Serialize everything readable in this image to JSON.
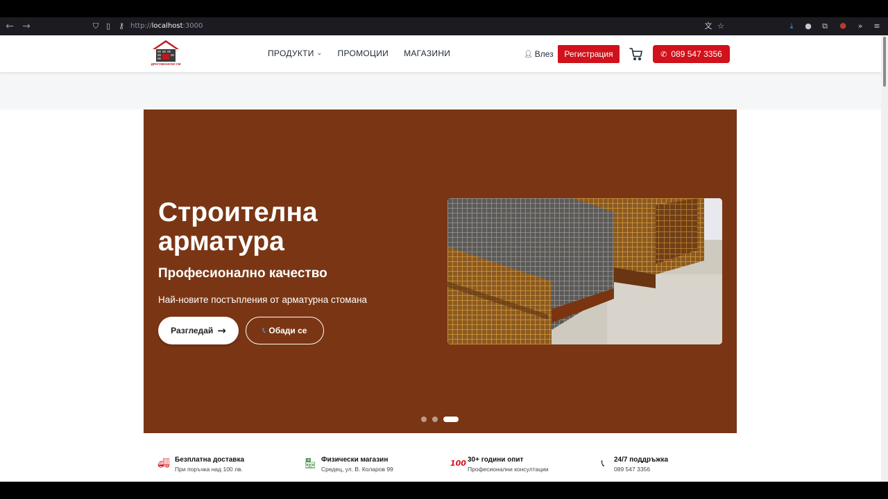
{
  "browser": {
    "url_prefix": "http://",
    "url_host": "localhost",
    "url_port": ":3000"
  },
  "header": {
    "logo_caption": "ДРАГОМАНСКИ СМ",
    "nav": [
      {
        "label": "ПРОДУКТИ",
        "has_dropdown": true
      },
      {
        "label": "ПРОМОЦИИ"
      },
      {
        "label": "МАГАЗИНИ"
      }
    ],
    "login_label": "Влез",
    "register_label": "Регистрация",
    "phone_label": "089 547 3356"
  },
  "hero": {
    "title": "Строителна арматура",
    "subtitle": "Професионално качество",
    "description": "Най-новите постъпления от арматурна стомана",
    "browse_label": "Разгледай",
    "browse_arrow": "→",
    "call_label": "Обади се",
    "slide_count": 3,
    "active_slide": 3,
    "background_color": "#7a3614"
  },
  "features": [
    {
      "icon": "delivery-truck-icon",
      "title": "Безплатна доставка",
      "subtitle": "При поръчка над 100 лв."
    },
    {
      "icon": "store-icon",
      "title": "Физически магазин",
      "subtitle": "Средец, ул. В. Коларов 99"
    },
    {
      "icon": "hundred-icon",
      "title": "30+ години опит",
      "subtitle": "Професионални консултации"
    },
    {
      "icon": "phone-icon",
      "title": "24/7 поддръжка",
      "subtitle": "089 547 3356"
    }
  ],
  "colors": {
    "brand_red": "#d1111b",
    "hero_brown": "#7a3614"
  }
}
